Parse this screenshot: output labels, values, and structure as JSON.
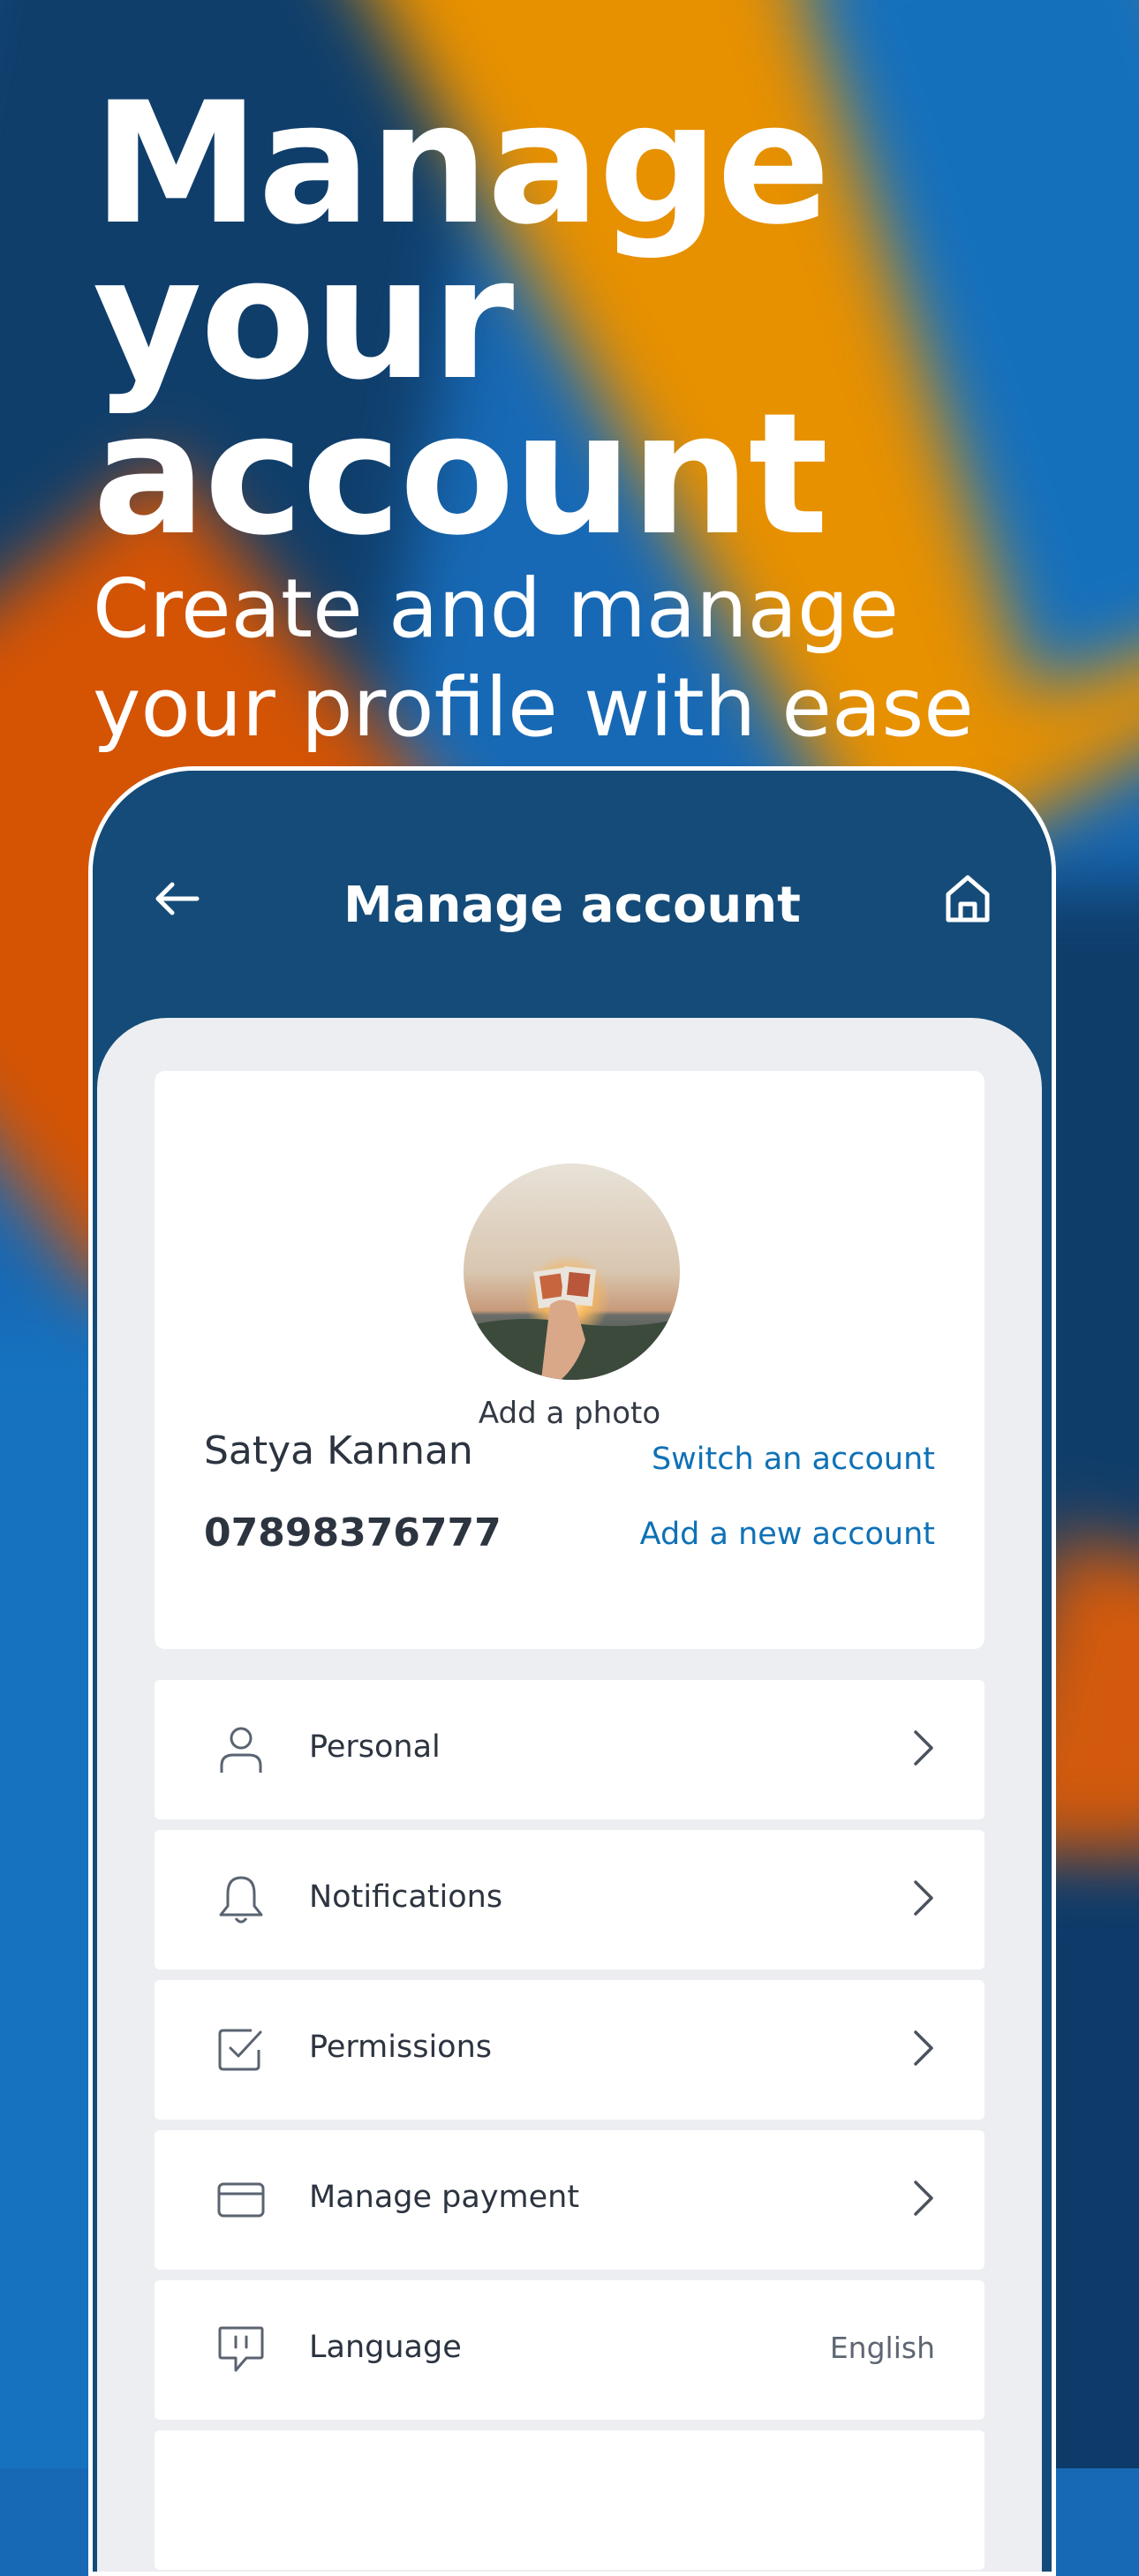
{
  "promo": {
    "title_line1": "Manage",
    "title_line2": "your account",
    "subtitle_line1": "Create and manage",
    "subtitle_line2": "your profile with ease"
  },
  "header": {
    "title": "Manage account",
    "back_icon": "arrow-left-icon",
    "home_icon": "home-icon"
  },
  "profile": {
    "add_photo_label": "Add a photo",
    "name": "Satya Kannan",
    "phone": "07898376777",
    "switch_account_label": "Switch an account",
    "add_account_label": "Add a new account",
    "link_color": "#0f71b6"
  },
  "menu": {
    "items": [
      {
        "label": "Personal",
        "icon": "person-icon"
      },
      {
        "label": "Notifications",
        "icon": "bell-icon"
      },
      {
        "label": "Permissions",
        "icon": "checkbox-icon"
      },
      {
        "label": "Manage payment",
        "icon": "card-icon"
      },
      {
        "label": "Language",
        "icon": "chat-bubble-icon",
        "value": "English"
      }
    ]
  },
  "colors": {
    "header_bg": "#144b78",
    "content_bg": "#eceef1",
    "orange": "#e79000",
    "navy": "#0f3e6b",
    "blue": "#1672bf",
    "red": "#d45404"
  }
}
